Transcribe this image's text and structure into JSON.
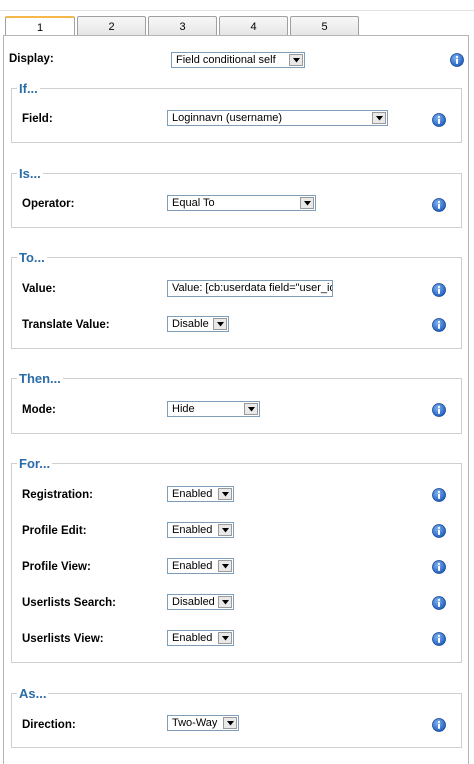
{
  "tabs": [
    "1",
    "2",
    "3",
    "4",
    "5"
  ],
  "display": {
    "label": "Display:",
    "value": "Field conditional self"
  },
  "if": {
    "legend": "If...",
    "field_label": "Field:",
    "field_value": "Loginnavn (username)"
  },
  "is": {
    "legend": "Is...",
    "operator_label": "Operator:",
    "operator_value": "Equal To"
  },
  "to": {
    "legend": "To...",
    "value_label": "Value:",
    "value_text": "Value: [cb:userdata field=\"user_id\"",
    "translate_label": "Translate Value:",
    "translate_value": "Disable"
  },
  "then": {
    "legend": "Then...",
    "mode_label": "Mode:",
    "mode_value": "Hide"
  },
  "for": {
    "legend": "For...",
    "registration_label": "Registration:",
    "registration_value": "Enabled",
    "profile_edit_label": "Profile Edit:",
    "profile_edit_value": "Enabled",
    "profile_view_label": "Profile View:",
    "profile_view_value": "Enabled",
    "userlists_search_label": "Userlists Search:",
    "userlists_search_value": "Disabled",
    "userlists_view_label": "Userlists View:",
    "userlists_view_value": "Enabled"
  },
  "as": {
    "legend": "As...",
    "direction_label": "Direction:",
    "direction_value": "Two-Way"
  },
  "colors": {
    "legend": "#2b6ca8",
    "active_tab": "#f5b64a",
    "info_icon": "#1f5fbf"
  }
}
